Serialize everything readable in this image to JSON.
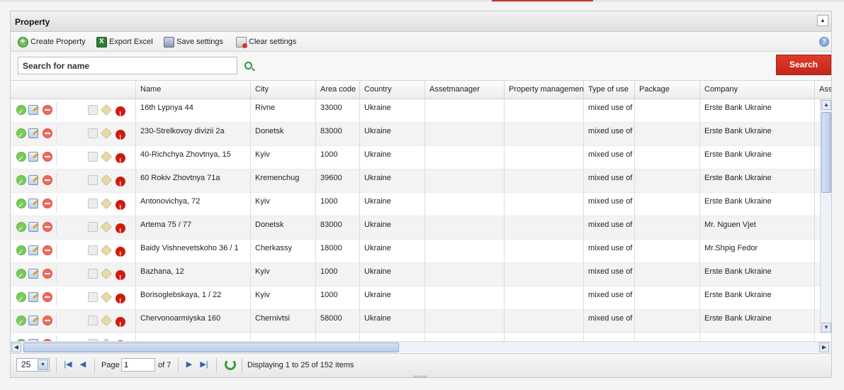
{
  "panel": {
    "title": "Property"
  },
  "toolbar": {
    "create_label": "Create Property",
    "export_label": "Export Excel",
    "save_label": "Save settings",
    "clear_label": "Clear settings"
  },
  "search": {
    "value": "Search for name",
    "button_label": "Search"
  },
  "columns": [
    "Name",
    "City",
    "Area code",
    "Country",
    "Assetmanager",
    "Property management",
    "Type of use",
    "Package",
    "Company",
    "Ass"
  ],
  "rows": [
    {
      "name": "16th Lypnya 44",
      "city": "Rivne",
      "area_code": "33000",
      "country": "Ukraine",
      "assetmanager": "",
      "property_management": "",
      "type_of_use": "mixed use of",
      "package": "",
      "company": "Erste Bank Ukraine"
    },
    {
      "name": "230-Strelkovoy divizii 2a",
      "city": "Donetsk",
      "area_code": "83000",
      "country": "Ukraine",
      "assetmanager": "",
      "property_management": "",
      "type_of_use": "mixed use of",
      "package": "",
      "company": "Erste Bank Ukraine"
    },
    {
      "name": "40-Richchya Zhovtnya, 15",
      "city": "Kyiv",
      "area_code": "1000",
      "country": "Ukraine",
      "assetmanager": "",
      "property_management": "",
      "type_of_use": "mixed use of",
      "package": "",
      "company": "Erste Bank Ukraine"
    },
    {
      "name": "60 Rokiv Zhovtnya 71a",
      "city": "Kremenchug",
      "area_code": "39600",
      "country": "Ukraine",
      "assetmanager": "",
      "property_management": "",
      "type_of_use": "mixed use of",
      "package": "",
      "company": "Erste Bank Ukraine"
    },
    {
      "name": "Antonovichya, 72",
      "city": "Kyiv",
      "area_code": "1000",
      "country": "Ukraine",
      "assetmanager": "",
      "property_management": "",
      "type_of_use": "mixed use of",
      "package": "",
      "company": "Erste Bank Ukraine"
    },
    {
      "name": "Artema 75 / 77",
      "city": "Donetsk",
      "area_code": "83000",
      "country": "Ukraine",
      "assetmanager": "",
      "property_management": "",
      "type_of_use": "mixed use of",
      "package": "",
      "company": "Mr. Nguen Vjet"
    },
    {
      "name": "Baidy Vishnevetskoho 36 / 1",
      "city": "Cherkassy",
      "area_code": "18000",
      "country": "Ukraine",
      "assetmanager": "",
      "property_management": "",
      "type_of_use": "mixed use of",
      "package": "",
      "company": "Mr.Shpig Fedor"
    },
    {
      "name": "Bazhana, 12",
      "city": "Kyiv",
      "area_code": "1000",
      "country": "Ukraine",
      "assetmanager": "",
      "property_management": "",
      "type_of_use": "mixed use of",
      "package": "",
      "company": "Erste Bank Ukraine"
    },
    {
      "name": "Borisoglebskaya, 1 / 22",
      "city": "Kyiv",
      "area_code": "1000",
      "country": "Ukraine",
      "assetmanager": "",
      "property_management": "",
      "type_of_use": "mixed use of",
      "package": "",
      "company": "Erste Bank Ukraine"
    },
    {
      "name": "Chervonoarmiyska 160",
      "city": "Chernivtsi",
      "area_code": "58000",
      "country": "Ukraine",
      "assetmanager": "",
      "property_management": "",
      "type_of_use": "mixed use of",
      "package": "",
      "company": "Erste Bank Ukraine"
    },
    {
      "name": "",
      "city": "",
      "area_code": "",
      "country": "",
      "assetmanager": "",
      "property_management": "",
      "type_of_use": "",
      "package": "",
      "company": ""
    }
  ],
  "pager": {
    "page_size": "25",
    "page_label": "Page",
    "page_value": "1",
    "of_label": "of 7",
    "display_text": "Displaying 1 to 25 of 152 items"
  },
  "icons": {
    "row_actions": [
      "approve-icon",
      "edit-icon",
      "delete-icon",
      "copy-icon",
      "tag-icon",
      "alert-icon"
    ]
  },
  "colors": {
    "accent": "#d9362a",
    "header_bg": "#e6e6e6"
  }
}
